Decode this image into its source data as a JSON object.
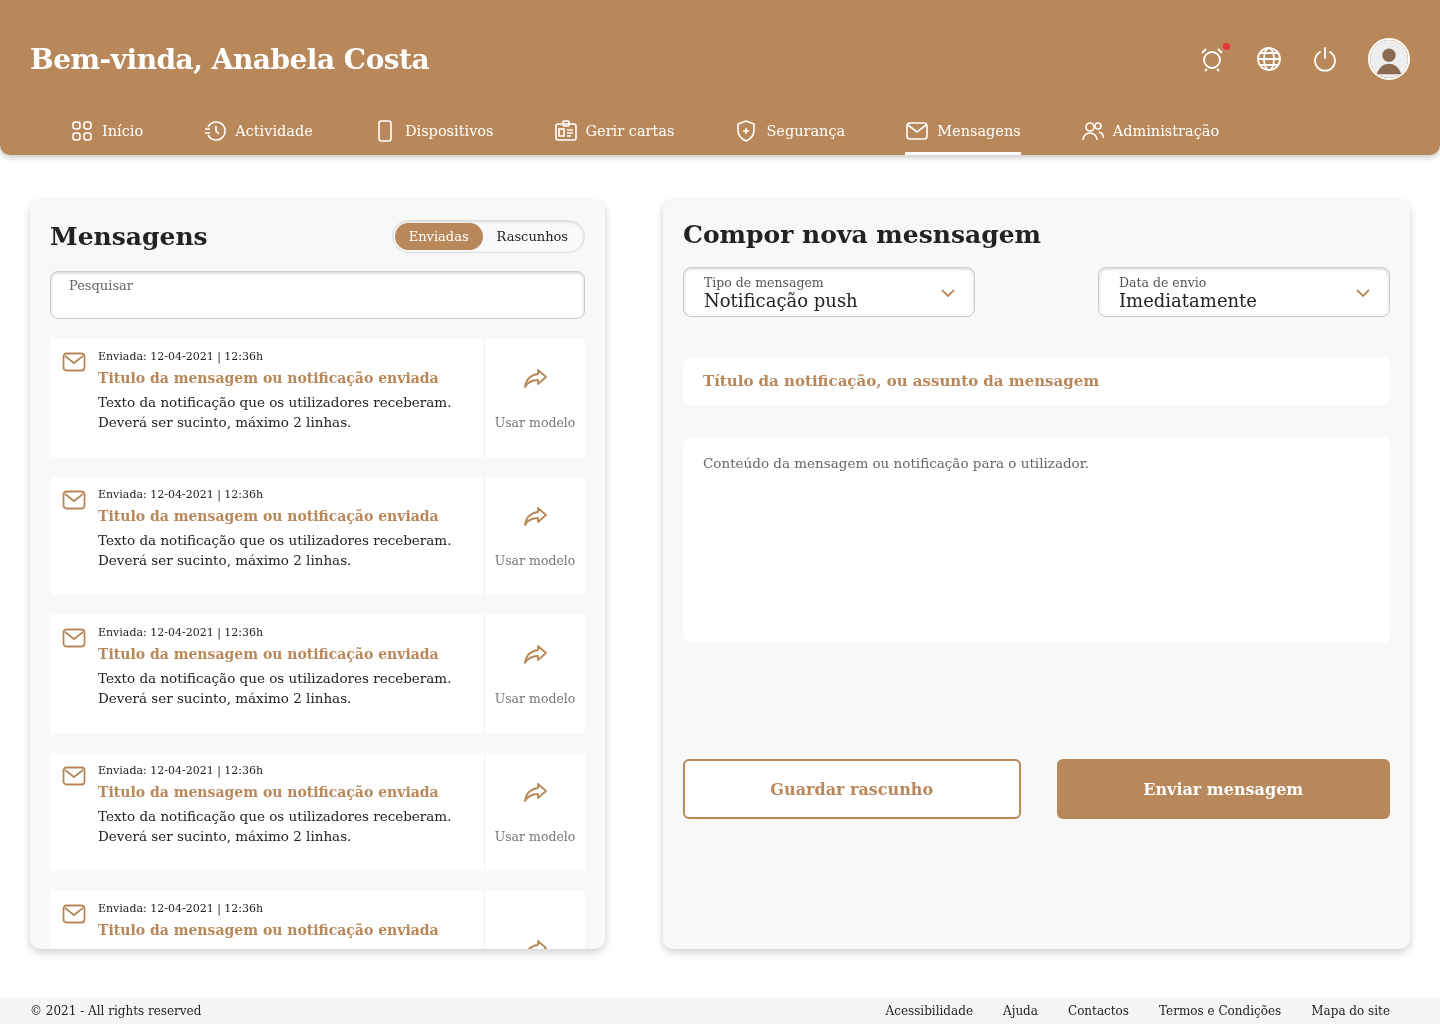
{
  "header": {
    "title": "Bem-vinda, Anabela Costa",
    "alert_unread": true
  },
  "tabs": [
    {
      "label": "Início",
      "selected": false
    },
    {
      "label": "Actividade",
      "selected": false
    },
    {
      "label": "Dispositivos",
      "selected": false
    },
    {
      "label": "Gerir cartas",
      "selected": false
    },
    {
      "label": "Segurança",
      "selected": false
    },
    {
      "label": "Mensagens",
      "selected": true
    },
    {
      "label": "Administração",
      "selected": false
    }
  ],
  "messages_panel": {
    "title": "Mensagens",
    "filters": [
      {
        "label": "Enviadas",
        "selected": true
      },
      {
        "label": "Rascunhos",
        "selected": false
      }
    ],
    "search": {
      "placeholder": "Pesquisar"
    },
    "items": [
      {
        "sent": "Enviada: 12-04-2021 | 12:36h",
        "title": "Titulo da mensagem ou notificação enviada",
        "body": "Texto da notificação que os utilizadores receberam. Deverá ser sucinto, máximo 2 linhas.",
        "action": "Usar modelo"
      },
      {
        "sent": "Enviada: 12-04-2021 | 12:36h",
        "title": "Titulo da mensagem ou notificação enviada",
        "body": "Texto da notificação que os utilizadores receberam. Deverá ser sucinto, máximo 2 linhas.",
        "action": "Usar modelo"
      },
      {
        "sent": "Enviada: 12-04-2021 | 12:36h",
        "title": "Titulo da mensagem ou notificação enviada",
        "body": "Texto da notificação que os utilizadores receberam. Deverá ser sucinto, máximo 2 linhas.",
        "action": "Usar modelo"
      },
      {
        "sent": "Enviada: 12-04-2021 | 12:36h",
        "title": "Titulo da mensagem ou notificação enviada",
        "body": "Texto da notificação que os utilizadores receberam. Deverá ser sucinto, máximo 2 linhas.",
        "action": "Usar modelo"
      },
      {
        "sent": "Enviada: 12-04-2021 | 12:36h",
        "title": "Titulo da mensagem ou notificação enviada"
      }
    ]
  },
  "compose": {
    "title": "Compor nova mesnsagem",
    "selects": [
      {
        "label": "Tipo de mensagem",
        "value": "Notificação push"
      },
      {
        "label": "Data de envio",
        "value": "Imediatamente"
      }
    ],
    "subject": {
      "placeholder": "Título da notificação, ou assunto da mensagem"
    },
    "content": {
      "placeholder": "Conteúdo da mensagem ou notificação para o utilizador."
    },
    "buttons": [
      {
        "label": "Guardar rascunho",
        "kind": "outline"
      },
      {
        "label": "Enviar mensagem",
        "kind": "primary"
      }
    ]
  },
  "footer": {
    "copyright": "© 2021 - All rights reserved",
    "links": [
      "Acessibilidade",
      "Ajuda",
      "Contactos",
      "Termos e Condições",
      "Mapa do site"
    ]
  }
}
